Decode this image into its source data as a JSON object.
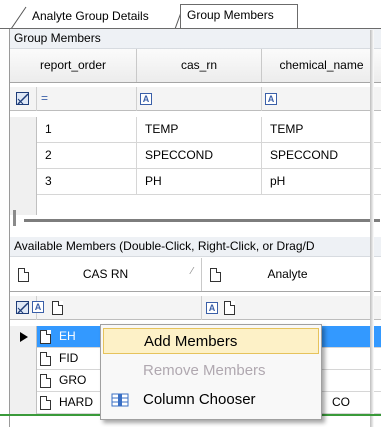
{
  "tabs": [
    {
      "label": "Analyte Group Details"
    },
    {
      "label": "Group Members"
    }
  ],
  "group_members": {
    "caption": "Group Members",
    "columns": [
      "report_order",
      "cas_rn",
      "chemical_name"
    ],
    "filter_operator": "=",
    "rows": [
      {
        "report_order": "1",
        "cas_rn": "TEMP",
        "chemical_name": "TEMP"
      },
      {
        "report_order": "2",
        "cas_rn": "SPECCOND",
        "chemical_name": "SPECCOND"
      },
      {
        "report_order": "3",
        "cas_rn": "PH",
        "chemical_name": "pH"
      }
    ]
  },
  "available_members": {
    "caption": "Available Members  (Double-Click, Right-Click, or Drag/D",
    "columns": [
      "CAS RN",
      "Analyte"
    ],
    "rows": [
      {
        "cas_rn": "EH",
        "analyte": ""
      },
      {
        "cas_rn": "FID",
        "analyte": ""
      },
      {
        "cas_rn": "GRO",
        "analyte": ""
      },
      {
        "cas_rn": "HARD",
        "analyte": "CO"
      }
    ]
  },
  "context_menu": {
    "items": [
      {
        "label": "Add Members",
        "state": "highlighted"
      },
      {
        "label": "Remove Members",
        "state": "disabled"
      },
      {
        "label": "Column Chooser",
        "state": "normal",
        "icon": "column-chooser-icon"
      }
    ]
  },
  "colors": {
    "selection_blue": "#3399ff",
    "menu_highlight": "#fdf1c7",
    "accent_green": "#3a9a3a"
  }
}
